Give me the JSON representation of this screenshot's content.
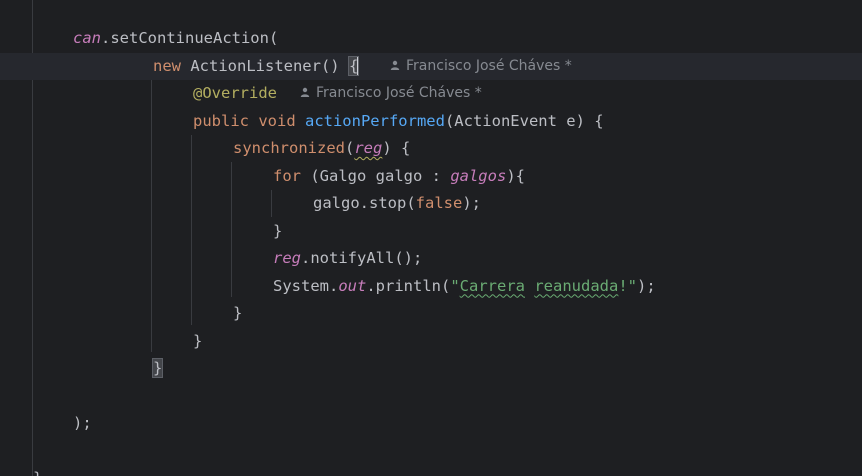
{
  "editor": {
    "language": "Java",
    "current_line_index": 1,
    "lines": [
      {
        "id": "l0",
        "tokens": [
          {
            "t": "can",
            "c": "field"
          },
          {
            "t": ".setContinueAction(",
            "c": "plain"
          }
        ]
      },
      {
        "id": "l1",
        "tokens": [
          {
            "t": "new ",
            "c": "kw"
          },
          {
            "t": "ActionListener() ",
            "c": "plain"
          },
          {
            "t": "{",
            "c": "brace"
          }
        ],
        "inlay": "Francisco José Cháves *"
      },
      {
        "id": "l2",
        "tokens": [
          {
            "t": "@Override",
            "c": "ann"
          }
        ],
        "inlay": "Francisco José Cháves *"
      },
      {
        "id": "l3",
        "tokens": [
          {
            "t": "public void ",
            "c": "kw"
          },
          {
            "t": "actionPerformed",
            "c": "fn"
          },
          {
            "t": "(ActionEvent e) {",
            "c": "plain"
          }
        ]
      },
      {
        "id": "l4",
        "tokens": [
          {
            "t": "synchronized",
            "c": "kw"
          },
          {
            "t": "(",
            "c": "plain"
          },
          {
            "t": "reg",
            "c": "field-squiggle"
          },
          {
            "t": ") {",
            "c": "plain"
          }
        ]
      },
      {
        "id": "l5",
        "tokens": [
          {
            "t": "for ",
            "c": "kw"
          },
          {
            "t": "(Galgo galgo : ",
            "c": "plain"
          },
          {
            "t": "galgos",
            "c": "field"
          },
          {
            "t": "){",
            "c": "plain"
          }
        ]
      },
      {
        "id": "l6",
        "tokens": [
          {
            "t": "galgo.stop(",
            "c": "plain"
          },
          {
            "t": "false",
            "c": "kw"
          },
          {
            "t": ");",
            "c": "plain"
          }
        ]
      },
      {
        "id": "l7",
        "tokens": [
          {
            "t": "}",
            "c": "plain"
          }
        ]
      },
      {
        "id": "l8",
        "tokens": [
          {
            "t": "reg",
            "c": "field"
          },
          {
            "t": ".notifyAll();",
            "c": "plain"
          }
        ]
      },
      {
        "id": "l9",
        "tokens": [
          {
            "t": "System.",
            "c": "plain"
          },
          {
            "t": "out",
            "c": "field"
          },
          {
            "t": ".println(",
            "c": "plain"
          },
          {
            "t": "\"",
            "c": "str"
          },
          {
            "t": "Carrera",
            "c": "str-spell"
          },
          {
            "t": " ",
            "c": "str"
          },
          {
            "t": "reanudada",
            "c": "str-spell"
          },
          {
            "t": "!\"",
            "c": "str"
          },
          {
            "t": ");",
            "c": "plain"
          }
        ]
      },
      {
        "id": "l10",
        "tokens": [
          {
            "t": "}",
            "c": "plain"
          }
        ]
      },
      {
        "id": "l11",
        "tokens": [
          {
            "t": "}",
            "c": "plain"
          }
        ]
      },
      {
        "id": "l12",
        "tokens": [
          {
            "t": "}",
            "c": "brace"
          }
        ]
      },
      {
        "id": "l13",
        "tokens": []
      },
      {
        "id": "l14",
        "tokens": [
          {
            "t": ");",
            "c": "plain"
          }
        ]
      },
      {
        "id": "l15",
        "tokens": []
      },
      {
        "id": "l16",
        "tokens": [
          {
            "t": "}",
            "c": "plain"
          }
        ]
      }
    ]
  },
  "colors": {
    "background": "#1e1f22",
    "current_line": "#26282e",
    "keyword": "#cf8e6d",
    "function": "#56a8f5",
    "field": "#c77dbb",
    "string": "#6aab73",
    "annotation": "#b3ae60",
    "text": "#bcbec4",
    "inlay": "#868a91"
  },
  "icons": {
    "author_hint": "user-icon"
  }
}
